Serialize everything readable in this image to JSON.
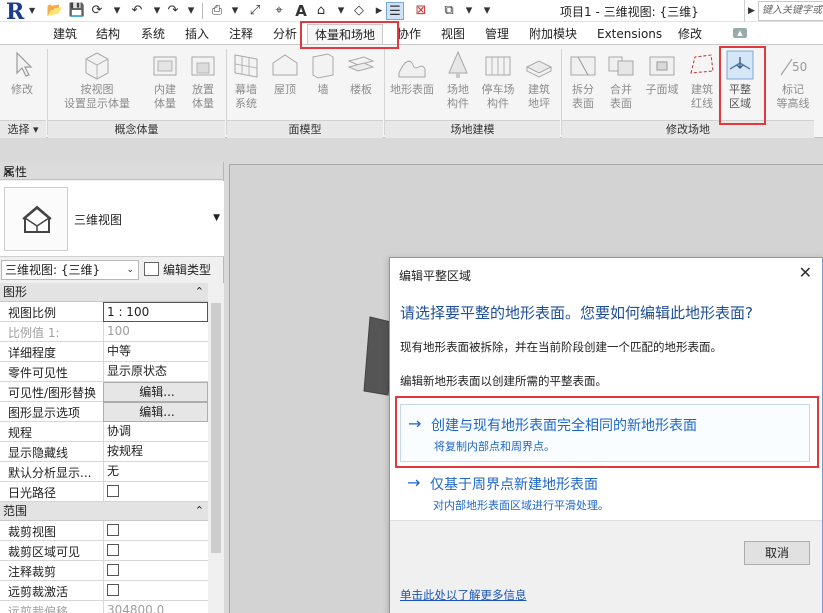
{
  "title_bar": {
    "window_title": "项目1 - 三维视图: {三维}",
    "search_placeholder": "键入关键字或"
  },
  "tabs": [
    {
      "label": "建筑"
    },
    {
      "label": "结构"
    },
    {
      "label": "系统"
    },
    {
      "label": "插入"
    },
    {
      "label": "注释"
    },
    {
      "label": "分析"
    },
    {
      "label": "体量和场地",
      "active": true
    },
    {
      "label": "协作"
    },
    {
      "label": "视图"
    },
    {
      "label": "管理"
    },
    {
      "label": "附加模块"
    },
    {
      "label": "Extensions"
    },
    {
      "label": "修改"
    }
  ],
  "ribbon": {
    "select": {
      "modify": "修改",
      "panel": "选择"
    },
    "conceptual_mass": {
      "show_mass": [
        "按视图",
        "设置显示体量"
      ],
      "in_place_mass": [
        "内建",
        "体量"
      ],
      "place_mass": [
        "放置",
        "体量"
      ],
      "panel": "概念体量"
    },
    "model_by_face": {
      "curtain_system": [
        "幕墙",
        "系统"
      ],
      "roof": "屋顶",
      "wall": "墙",
      "floor": "楼板",
      "panel": "面模型"
    },
    "site_model": {
      "toposurface": "地形表面",
      "site_component": [
        "场地",
        "构件"
      ],
      "parking_component": [
        "停车场",
        "构件"
      ],
      "building_pad": [
        "建筑",
        "地坪"
      ],
      "panel": "场地建模"
    },
    "modify_site": {
      "split_surface": [
        "拆分",
        "表面"
      ],
      "merge_surfaces": [
        "合并",
        "表面"
      ],
      "subregion": "子面域",
      "property_line": [
        "建筑",
        "红线"
      ],
      "graded_region": [
        "平整",
        "区域"
      ],
      "label_contours": [
        "标记",
        "等高线"
      ],
      "label_contours_value": "50",
      "panel": "修改场地"
    }
  },
  "properties": {
    "header": "属性",
    "type_name": "三维视图",
    "view_selector": "三维视图: {三维}",
    "edit_type": "编辑类型",
    "sections": {
      "graphics": "图形",
      "extents": "范围"
    },
    "graphics_rows": [
      {
        "k": "视图比例",
        "v": "1 : 100"
      },
      {
        "k": "比例值 1:",
        "v": "100"
      },
      {
        "k": "详细程度",
        "v": "中等"
      },
      {
        "k": "零件可见性",
        "v": "显示原状态"
      },
      {
        "k": "可见性/图形替换",
        "v": "编辑..."
      },
      {
        "k": "图形显示选项",
        "v": "编辑..."
      },
      {
        "k": "规程",
        "v": "协调"
      },
      {
        "k": "显示隐藏线",
        "v": "按规程"
      },
      {
        "k": "默认分析显示...",
        "v": "无"
      },
      {
        "k": "日光路径",
        "v": ""
      }
    ],
    "extents_rows": [
      {
        "k": "裁剪视图",
        "v": ""
      },
      {
        "k": "裁剪区域可见",
        "v": ""
      },
      {
        "k": "注释裁剪",
        "v": ""
      },
      {
        "k": "远剪裁激活",
        "v": ""
      },
      {
        "k": "远剪裁偏移",
        "v": "304800.0"
      }
    ]
  },
  "dialog": {
    "title": "编辑平整区域",
    "question": "请选择要平整的地形表面。您要如何编辑此地形表面?",
    "para1": "现有地形表面被拆除，并在当前阶段创建一个匹配的地形表面。",
    "para2": "编辑新地形表面以创建所需的平整表面。",
    "option1": {
      "main": "创建与现有地形表面完全相同的新地形表面",
      "sub": "将复制内部点和周界点。"
    },
    "option2": {
      "main": "仅基于周界点新建地形表面",
      "sub": "对内部地形表面区域进行平滑处理。"
    },
    "cancel": "取消",
    "learn_more": "单击此处以了解更多信息"
  },
  "colors": {
    "accent": "#1e66c8",
    "highlight": "#e0393e"
  }
}
